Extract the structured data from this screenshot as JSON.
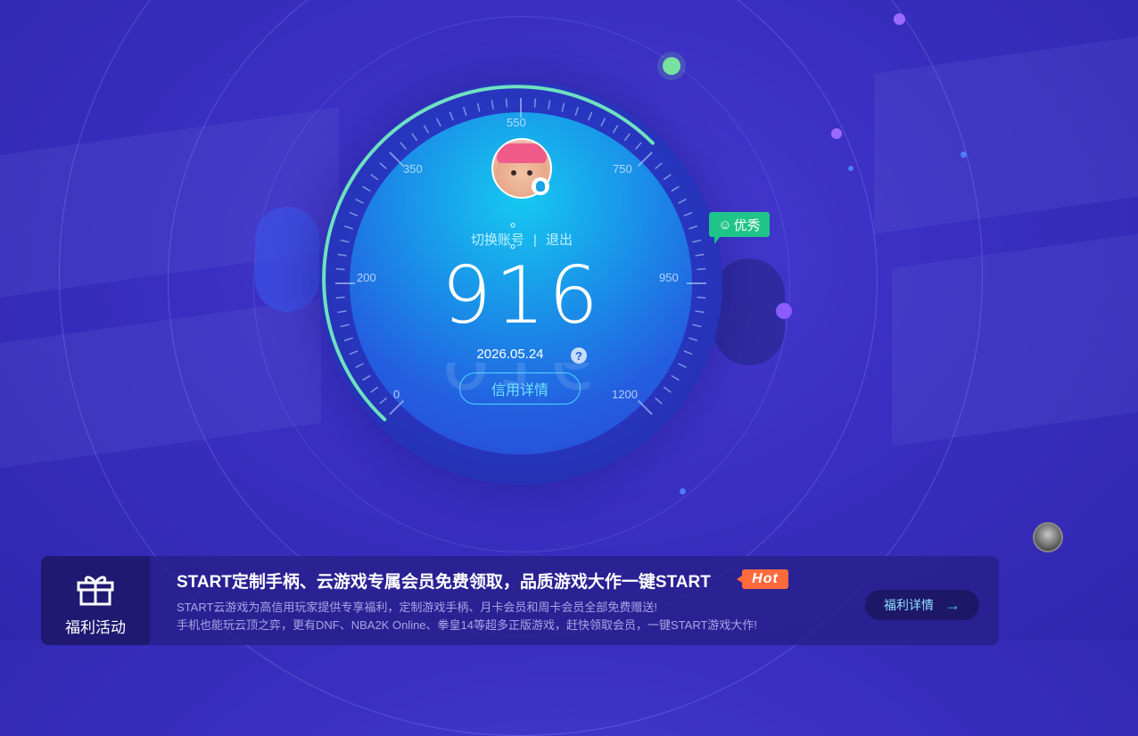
{
  "profile": {
    "nickname": "。 。",
    "switch_account": "切换账号",
    "separator": "|",
    "logout": "退出"
  },
  "credit": {
    "score": "916",
    "date": "2026.05.24",
    "help": "?",
    "detail_button": "信用详情",
    "rating": "优秀",
    "ticks": [
      "0",
      "200",
      "350",
      "550",
      "750",
      "950",
      "1200"
    ]
  },
  "promo": {
    "label": "福利活动",
    "title": "START定制手柄、云游戏专属会员免费领取，品质游戏大作一键START",
    "hot": "Hot",
    "desc_line1": "START云游戏为高信用玩家提供专享福利，定制游戏手柄、月卡会员和周卡会员全部免费赠送!",
    "desc_line2": "手机也能玩云顶之弈，更有DNF、NBA2K Online、拳皇14等超多正版游戏，赶快领取会员，一键START游戏大作!",
    "button": "福利详情"
  },
  "colors": {
    "background": "#3a2fc2",
    "accent_cyan": "#4fd4ff",
    "rating_green": "#1fc48a",
    "hot_orange": "#ff6a3d"
  }
}
